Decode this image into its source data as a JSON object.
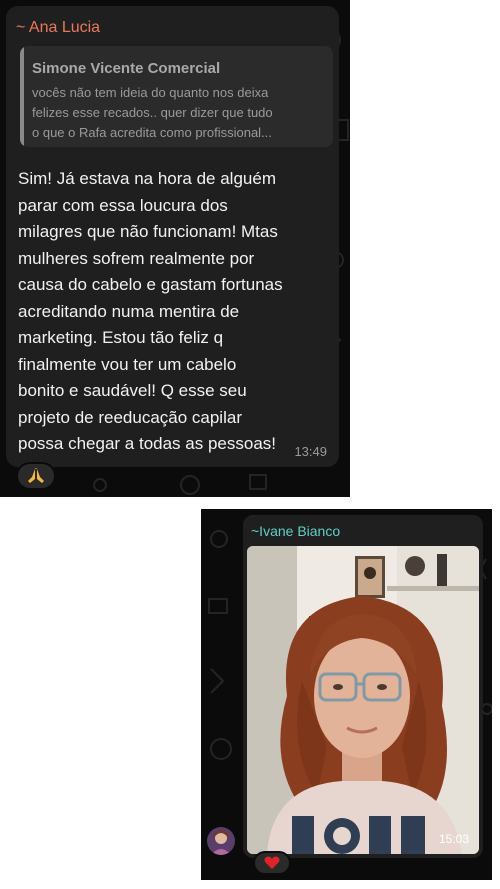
{
  "message1": {
    "sender": "~ Ana Lucia",
    "sender_color": "#e9785b",
    "quote": {
      "author": "Simone Vicente Comercial",
      "lines": [
        "vocês não tem ideia do quanto nos deixa",
        "felizes esse recados.. quer dizer que tudo",
        "o que o Rafa acredita como profissional..."
      ]
    },
    "text_lines": [
      "Sim! Já estava na hora de alguém",
      "parar com essa loucura dos",
      "milagres que não funcionam! Mtas",
      "mulheres sofrem realmente por",
      "causa do cabelo e gastam fortunas",
      "acreditando numa mentira de",
      "marketing. Estou tão feliz q",
      "finalmente vou ter um cabelo",
      "bonito e saudável! Q esse seu",
      "projeto de reeducação capilar",
      "possa chegar a todas as pessoas!"
    ],
    "time": "13:49",
    "reaction_icon": "praying-hands-icon"
  },
  "message2": {
    "sender": "~Ivane Bianco",
    "sender_color": "#5fd0c6",
    "photo_icon": "photo-image-icon",
    "time": "15:03",
    "reaction_icon": "red-heart-icon"
  }
}
